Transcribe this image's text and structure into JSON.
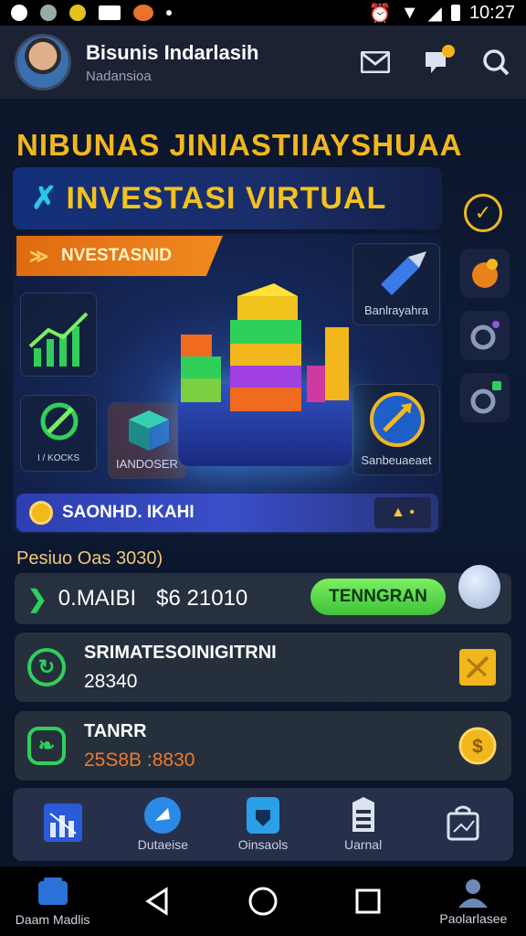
{
  "status_bar": {
    "time": "10:27"
  },
  "header": {
    "name": "Bisunis Indarlasih",
    "subtitle": "Nadansioa"
  },
  "banner": {
    "title": "NIBUNAS JINIASTIIAYSHUAA",
    "headline": "INVESTASI VIRTUAL"
  },
  "hero": {
    "tag": "NVESTASNID",
    "tile_top_right": "Banlrayahra",
    "tile_bottom_left": "I / KOCKS",
    "tile_bottom_mid": "IANDOSER",
    "tile_bottom_right": "Sanbeuaeaet",
    "bar_label": "SAONHD. IKAHI"
  },
  "period": "Pesiuo Oas 3030)",
  "invest": {
    "label": "0.MAIBI",
    "amount": "$6 21010",
    "button": "TENNGRAN"
  },
  "cards": [
    {
      "title": "SRIMATESOINIGITRNI",
      "value": "28340",
      "value_color": "#ffffff"
    },
    {
      "title": "TANRR",
      "value": "25S8B :8830",
      "value_color": "#f07a2a"
    }
  ],
  "nav": [
    {
      "label": "",
      "icon": "chart-icon"
    },
    {
      "label": "Dutaeise",
      "icon": "rocket-icon"
    },
    {
      "label": "Oinsaols",
      "icon": "shield-icon"
    },
    {
      "label": "Uarnal",
      "icon": "wallet-icon"
    },
    {
      "label": "",
      "icon": "bag-icon"
    }
  ],
  "system_nav": {
    "left_label": "Daam Madlis",
    "right_label": "Paolarlasee"
  },
  "colors": {
    "accent": "#f2b71c",
    "green": "#3fc23a",
    "panel": "#262f3c"
  }
}
